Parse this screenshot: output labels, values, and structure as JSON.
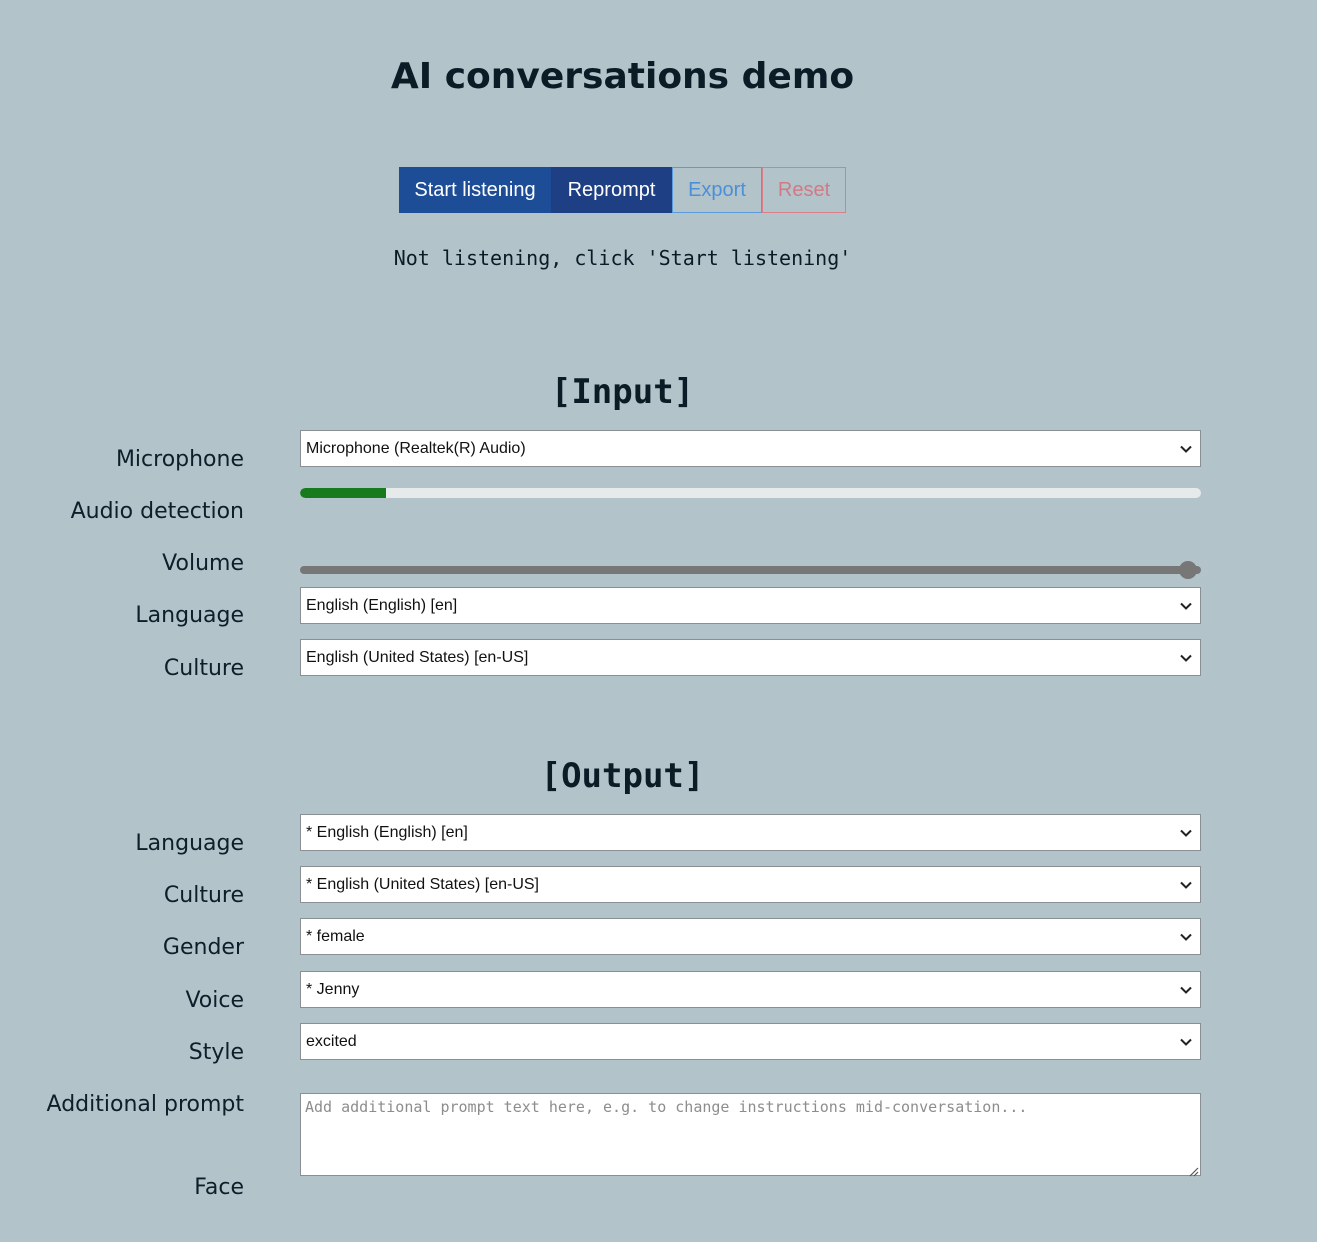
{
  "page": {
    "title": "AI conversations demo"
  },
  "toolbar": {
    "start_label": "Start listening",
    "reprompt_label": "Reprompt",
    "export_label": "Export",
    "reset_label": "Reset"
  },
  "status": {
    "text": "Not listening, click 'Start listening'"
  },
  "input": {
    "heading": "[Input]",
    "microphone": {
      "label": "Microphone",
      "value": "Microphone (Realtek(R) Audio)"
    },
    "audio_detection": {
      "label": "Audio detection",
      "level_fraction": 0.095
    },
    "volume": {
      "label": "Volume",
      "value_fraction": 1.0
    },
    "language": {
      "label": "Language",
      "value": "English (English) [en]"
    },
    "culture": {
      "label": "Culture",
      "value": "English (United States) [en-US]"
    }
  },
  "output": {
    "heading": "[Output]",
    "language": {
      "label": "Language",
      "value": "* English (English) [en]"
    },
    "culture": {
      "label": "Culture",
      "value": "* English (United States) [en-US]"
    },
    "gender": {
      "label": "Gender",
      "value": "* female"
    },
    "voice": {
      "label": "Voice",
      "value": "* Jenny"
    },
    "style": {
      "label": "Style",
      "value": "excited"
    },
    "additional_prompt": {
      "label": "Additional prompt",
      "value": "",
      "placeholder": "Add additional prompt text here, e.g. to change instructions mid-conversation..."
    },
    "face": {
      "label": "Face"
    }
  },
  "icons": {
    "dropdown": "chevron-down-icon",
    "resize": "resize-grip-icon"
  },
  "colors": {
    "background": "#b3c3ca",
    "primary_button": "#1d4d97",
    "secondary_button": "#1e3f83",
    "export_outline": "#4a90d9",
    "reset_outline": "#d17a86",
    "progress_fill": "#177a1c",
    "slider": "#777777"
  }
}
